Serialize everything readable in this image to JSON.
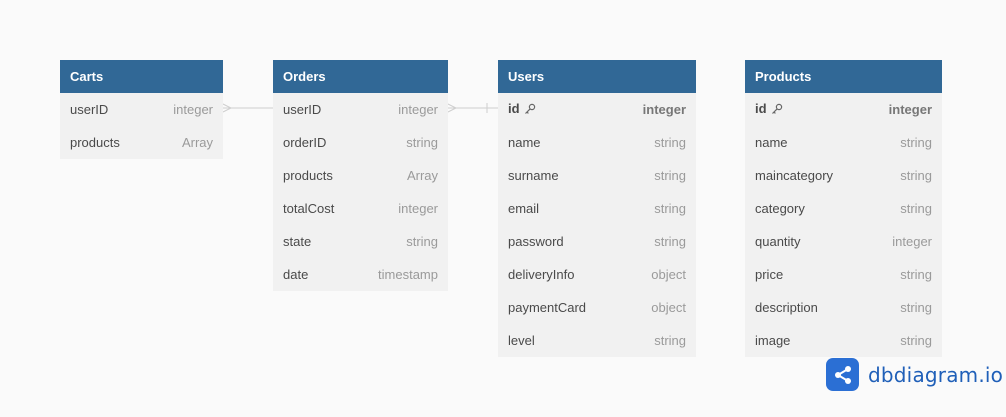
{
  "tables": {
    "carts": {
      "name": "Carts",
      "fields": [
        {
          "name": "userID",
          "type": "integer"
        },
        {
          "name": "products",
          "type": "Array"
        }
      ]
    },
    "orders": {
      "name": "Orders",
      "fields": [
        {
          "name": "userID",
          "type": "integer"
        },
        {
          "name": "orderID",
          "type": "string"
        },
        {
          "name": "products",
          "type": "Array"
        },
        {
          "name": "totalCost",
          "type": "integer"
        },
        {
          "name": "state",
          "type": "string"
        },
        {
          "name": "date",
          "type": "timestamp"
        }
      ]
    },
    "users": {
      "name": "Users",
      "fields": [
        {
          "name": "id",
          "type": "integer"
        },
        {
          "name": "name",
          "type": "string"
        },
        {
          "name": "surname",
          "type": "string"
        },
        {
          "name": "email",
          "type": "string"
        },
        {
          "name": "password",
          "type": "string"
        },
        {
          "name": "deliveryInfo",
          "type": "object"
        },
        {
          "name": "paymentCard",
          "type": "object"
        },
        {
          "name": "level",
          "type": "string"
        }
      ]
    },
    "products": {
      "name": "Products",
      "fields": [
        {
          "name": "id",
          "type": "integer"
        },
        {
          "name": "name",
          "type": "string"
        },
        {
          "name": "maincategory",
          "type": "string"
        },
        {
          "name": "category",
          "type": "string"
        },
        {
          "name": "quantity",
          "type": "integer"
        },
        {
          "name": "price",
          "type": "string"
        },
        {
          "name": "description",
          "type": "string"
        },
        {
          "name": "image",
          "type": "string"
        }
      ]
    }
  },
  "relationships": [
    {
      "from": "Carts.userID",
      "to": "Orders.userID",
      "from_card": "many",
      "to_card": "one"
    },
    {
      "from": "Orders.userID",
      "to": "Users.id",
      "from_card": "many",
      "to_card": "one"
    }
  ],
  "brand": {
    "text": "dbdiagram.io",
    "color": "#2b6fd4"
  },
  "colors": {
    "header": "#316896",
    "body": "#f1f1f1",
    "link": "#cfcfcf"
  }
}
